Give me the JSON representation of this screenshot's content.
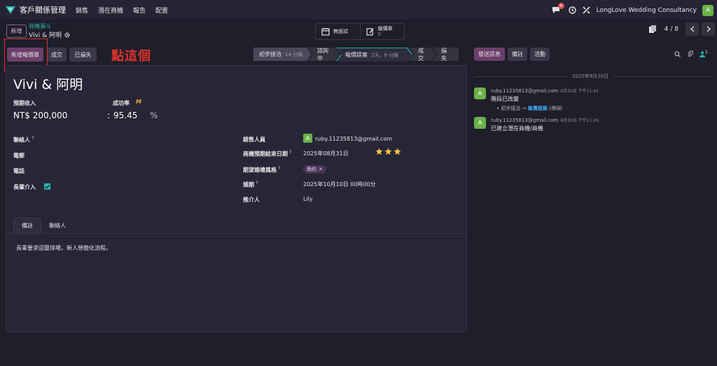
{
  "topbar": {
    "app_name": "客戶關係管理",
    "menu": [
      "銷售",
      "潛在商機",
      "報告",
      "配置"
    ],
    "chat_badge": "4",
    "company": "LongLove Wedding Consultancy",
    "user_initial": "A"
  },
  "breadcrumb": {
    "new_label": "新增",
    "parent": "商機漏斗",
    "current": "Vivi & 阿明"
  },
  "smart_buttons": {
    "meeting_label": "無面試",
    "quote_label": "報價單",
    "quote_count": "0"
  },
  "pager": {
    "text": "4 / 8"
  },
  "actions": {
    "new_quote": "新增報價單",
    "won": "成交",
    "lost": "已損失"
  },
  "annotation": "點這個",
  "stages": [
    {
      "label": "初步接洽",
      "duration": "14 分鐘"
    },
    {
      "label": "諮詢中",
      "duration": ""
    },
    {
      "label": "報價提案",
      "duration": "2天、9 分鐘"
    },
    {
      "label": "成交",
      "duration": ""
    },
    {
      "label": "損失",
      "duration": ""
    }
  ],
  "chatter_buttons": {
    "send": "發送訊息",
    "note": "備註",
    "activity": "活動"
  },
  "followers_count": "1",
  "record": {
    "title": "Vivi & 阿明",
    "expected_revenue_label": "預期收入",
    "expected_revenue": "NT$ 200,000",
    "probability_label": "成功率",
    "probability": "95.45",
    "probability_unit": "%",
    "contact_label": "聯絡人",
    "email_label": "電郵",
    "phone_label": "電話",
    "elder_label": "長輩介入",
    "elder_checked": true,
    "salesperson_label": "銷售人員",
    "salesperson": "ruby.11235813@gmail.com",
    "salesperson_initial": "A",
    "deadline_label": "商機預期結束日期",
    "deadline": "2025年08月31日",
    "stars": 3,
    "style_label": "期望婚禮風格",
    "style_tag": "簡約",
    "wedding_label": "婚期",
    "wedding_date": "2025年10月10日 00時00分",
    "referrer_label": "推介人",
    "referrer": "Lily"
  },
  "tabs": [
    "備註",
    "聯絡人"
  ],
  "notes": "長輩要求迎娶排場，新人想簡化流程。",
  "chatter": {
    "date": "2025年8月30日",
    "messages": [
      {
        "author": "ruby.11235813@gmail.com",
        "time": "8月30日 下午11:41",
        "body": "階段已改變",
        "from": "初步接洽",
        "to": "報價提案",
        "field": "(階段)"
      },
      {
        "author": "ruby.11235813@gmail.com",
        "time": "8月30日 下午11:26",
        "body": "已建立潛在商機/商機"
      }
    ]
  },
  "colors": {
    "accent": "#6b3f6a",
    "teal": "#2bb3a7",
    "red": "#d9322a",
    "avatar": "#6cb04a"
  }
}
